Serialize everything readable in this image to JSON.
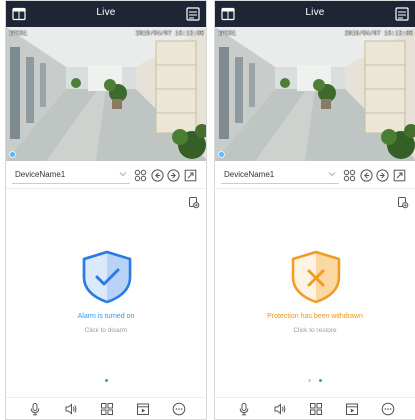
{
  "colors": {
    "topbar_bg": "#1e2635",
    "armed_accent": "#2b7ae6",
    "armed_text": "#3a96e6",
    "disarmed_accent": "#f29a22",
    "disarmed_text": "#f09419",
    "hint_text": "#9a9a9a",
    "page_dot_active": "#3a96e6",
    "page_dot_inactive": "#d0d0d0"
  },
  "screens": {
    "armed": {
      "title": "Live",
      "camera_osd_label": "IPC01",
      "camera_osd_time": "2019/04/07 16:13:05",
      "device_name": "DeviceName1",
      "status_icon": "shield-check-icon",
      "status_text": "Alarm is turned on",
      "hint_text": "Click to disarm"
    },
    "disarmed": {
      "title": "Live",
      "camera_osd_label": "IPC01",
      "camera_osd_time": "2019/04/07 16:13:05",
      "device_name": "DeviceName1",
      "status_icon": "shield-x-icon",
      "status_text": "Protection has been withdrawn",
      "hint_text": "Click to restore"
    }
  },
  "icons": {
    "top_left": "multi-view-icon",
    "top_right": "settings-panel-icon",
    "controls": [
      "ptz-icon",
      "rewind-icon",
      "forward-icon",
      "fullscreen-icon"
    ],
    "snapshot": "snapshot-icon",
    "toolbar": [
      "microphone-icon",
      "speaker-icon",
      "grid-icon",
      "playback-icon",
      "more-icon"
    ]
  }
}
